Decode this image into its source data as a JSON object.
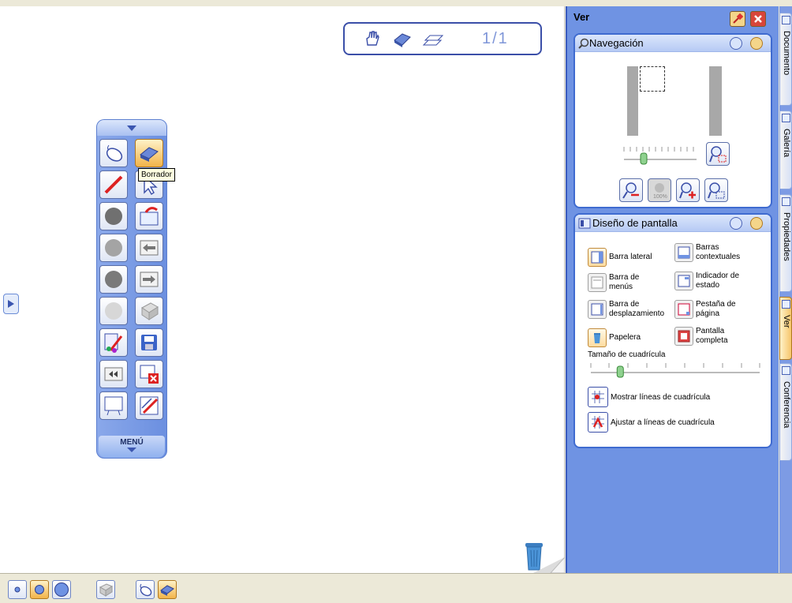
{
  "page_indicator": {
    "label": "1/1"
  },
  "toolbar": {
    "menu_label": "MENÚ",
    "tooltip": "Borrador",
    "buttons": [
      "mouse",
      "eraser",
      "pen",
      "select",
      "gray-pen",
      "pages-open",
      "gray-pen-2",
      "prev-page",
      "gray-pen-3",
      "next-page",
      "light-dot",
      "disabled-cube",
      "pen-color",
      "save",
      "rewind",
      "delete-page",
      "board",
      "edit-pen"
    ]
  },
  "right_panel": {
    "title": "Ver",
    "navigation": {
      "title": "Navegación"
    },
    "screen_layout": {
      "title": "Diseño de pantalla",
      "items": [
        {
          "label": "Barra lateral",
          "active": true
        },
        {
          "label": "Barras contextuales",
          "active": false
        },
        {
          "label": "Barra de menús",
          "active": false
        },
        {
          "label": "Indicador de estado",
          "active": false
        },
        {
          "label": "Barra de desplazamiento",
          "active": false
        },
        {
          "label": "Pestaña de página",
          "active": false
        },
        {
          "label": "Papelera",
          "active": true
        },
        {
          "label": "Pantalla completa",
          "active": false
        }
      ],
      "grid_size_label": "Tamaño de cuadrícula",
      "grid_size_value": 0.09,
      "show_grid_label": "Mostrar líneas de cuadrícula",
      "snap_grid_label": "Ajustar a líneas de cuadrícula"
    }
  },
  "tabs": [
    "Documento",
    "Galería",
    "Propiedades",
    "Ver",
    "Conferencia"
  ],
  "active_tab": "Ver",
  "colors": {
    "panel": "#6f93e3",
    "accent": "#f2b44a",
    "border": "#3b4fa8"
  }
}
